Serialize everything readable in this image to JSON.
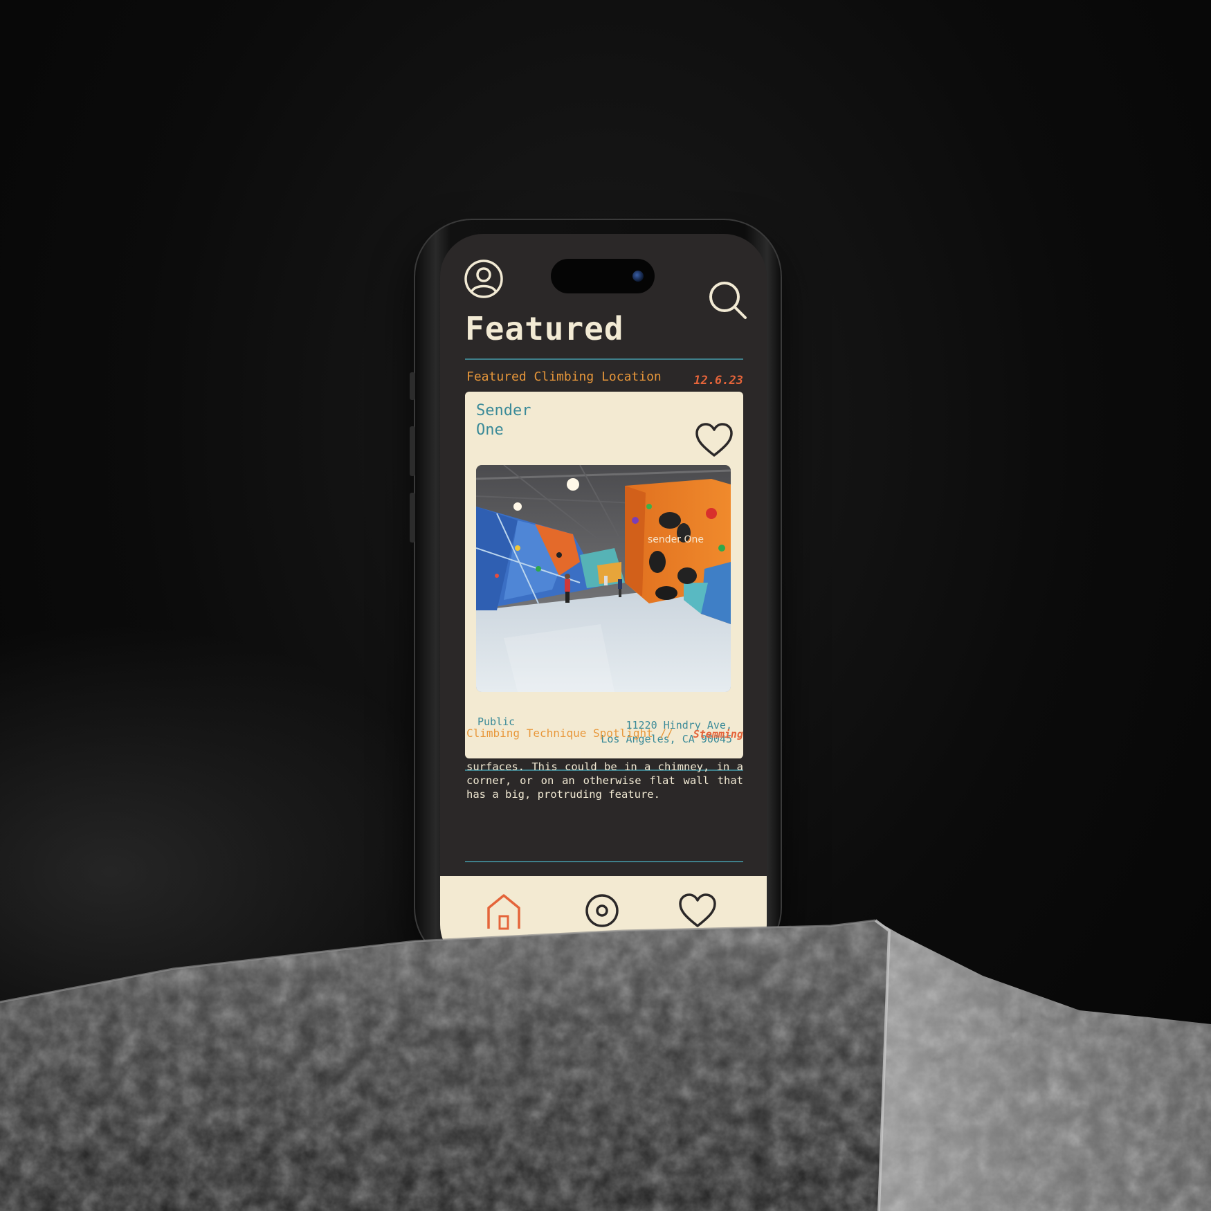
{
  "header": {
    "profile_icon": "user-circle-icon",
    "search_icon": "search-icon"
  },
  "page": {
    "title": "Featured"
  },
  "featured_location": {
    "section_label": "Featured Climbing Location",
    "date": "12.6.23",
    "name_line1": "Sender",
    "name_line2": "One",
    "favorite_icon": "heart-icon",
    "access": "Public",
    "address_line1": "11220 Hindry Ave,",
    "address_line2": "Los Angeles, CA 90045",
    "photo_sign_text": "sender One"
  },
  "technique": {
    "section_label": "Climbing Technique Spotlight //",
    "name": "Stemming",
    "body": "Stemming is pushing against two opposing surfaces. This could be in a chimney, in a corner, or on an otherwise flat wall that has a big, protruding feature."
  },
  "tabbar": {
    "active_tab": "home",
    "tabs": [
      "home-icon",
      "target-icon",
      "heart-icon"
    ]
  },
  "colors": {
    "background": "#2b2828",
    "card": "#f3ead2",
    "teal": "#3a8a98",
    "orange": "#e8973a",
    "red_orange": "#e4643a",
    "cream": "#f2ead4"
  }
}
